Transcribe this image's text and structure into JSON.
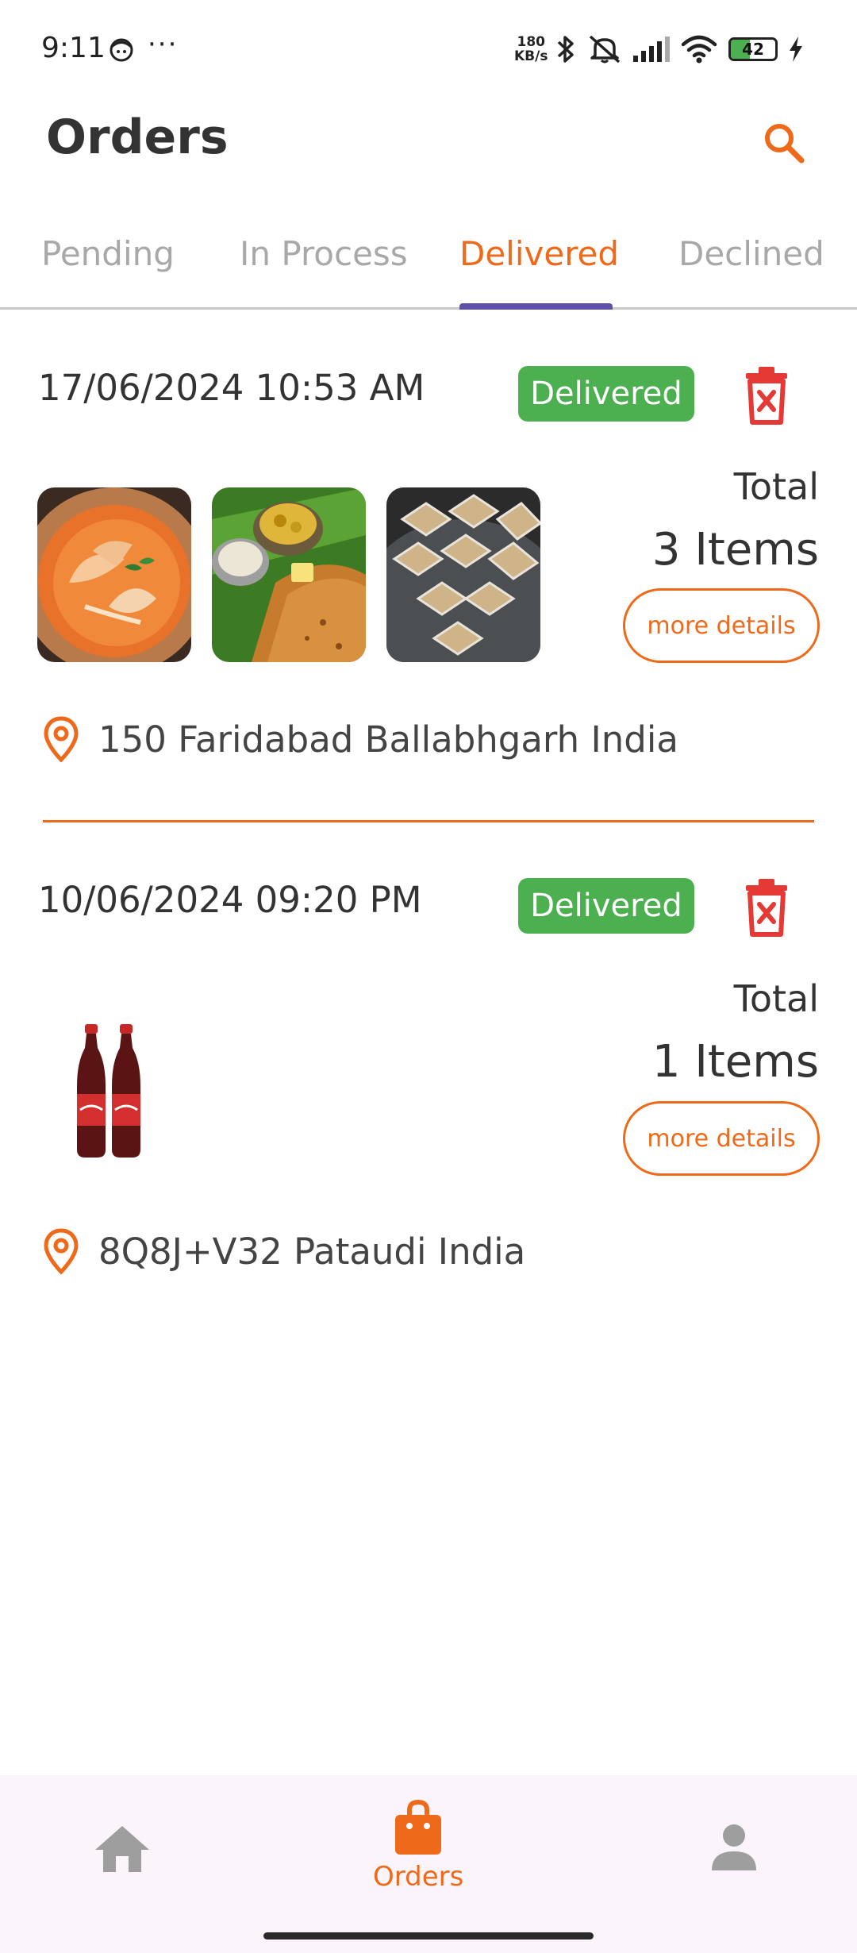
{
  "status_bar": {
    "time": "9:11",
    "more": "···",
    "net_speed_value": "180",
    "net_speed_unit": "KB/s",
    "battery_level": "42",
    "battery_fraction": 0.42,
    "icons": [
      "face-icon",
      "bluetooth-icon",
      "mute-icon",
      "signal-icon",
      "wifi-icon",
      "battery-icon",
      "charging-icon"
    ]
  },
  "header": {
    "title": "Orders",
    "search_icon": "search-icon"
  },
  "tabs": [
    {
      "label": "Pending",
      "active": false
    },
    {
      "label": "In Process",
      "active": false
    },
    {
      "label": "Delivered",
      "active": true
    },
    {
      "label": "Declined",
      "active": false
    }
  ],
  "orders": [
    {
      "datetime": "17/06/2024 10:53 AM",
      "status": "Delivered",
      "thumbnails": [
        "paneer-curry-image",
        "masala-dosa-image",
        "kaju-katli-image"
      ],
      "total_label": "Total",
      "items_count": "3 Items",
      "more_details": "more details",
      "address": "150 Faridabad Ballabhgarh India"
    },
    {
      "datetime": "10/06/2024 09:20 PM",
      "status": "Delivered",
      "thumbnails": [
        "coca-cola-bottles-image"
      ],
      "total_label": "Total",
      "items_count": "1 Items",
      "more_details": "more details",
      "address": "8Q8J+V32 Pataudi  India"
    }
  ],
  "bottom_nav": {
    "items": [
      {
        "icon": "home-icon",
        "label": "",
        "active": false
      },
      {
        "icon": "shopping-bag-icon",
        "label": "Orders",
        "active": true
      },
      {
        "icon": "person-icon",
        "label": "",
        "active": false
      }
    ]
  },
  "colors": {
    "accent": "#ee6a1a",
    "badge_green": "#4caf50",
    "tab_indicator": "#5e4fa8",
    "delete_red": "#e53935",
    "nav_bg": "#fbf4fb"
  }
}
